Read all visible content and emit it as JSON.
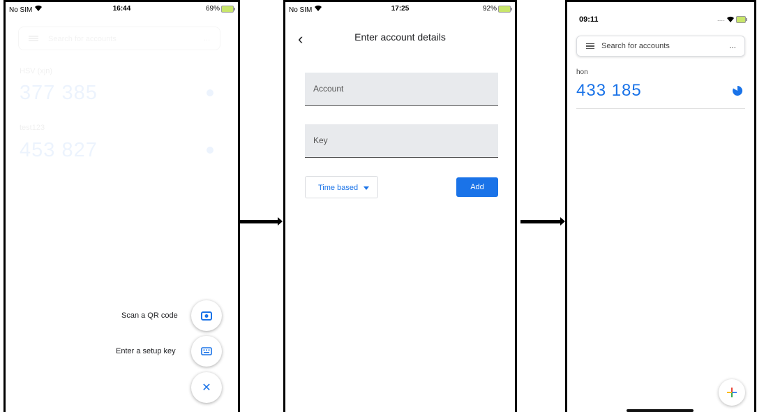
{
  "screen1": {
    "status": {
      "carrier": "No SIM",
      "time": "16:44",
      "battery": "69%"
    },
    "search_placeholder": "Search for accounts",
    "more": "...",
    "accounts": [
      {
        "name": "HSV (xjn)",
        "code": "377 385"
      },
      {
        "name": "test123",
        "code": "453 827"
      }
    ],
    "fab_menu": {
      "scan_label": "Scan a QR code",
      "key_label": "Enter a setup key",
      "close_glyph": "✕"
    }
  },
  "screen2": {
    "status": {
      "carrier": "No SIM",
      "time": "17:25",
      "battery": "92%"
    },
    "back_glyph": "‹",
    "title": "Enter account details",
    "account_placeholder": "Account",
    "key_placeholder": "Key",
    "type_select": "Time based",
    "add_label": "Add"
  },
  "screen3": {
    "status": {
      "time": "09:11",
      "signal": "...."
    },
    "search_placeholder": "Search for accounts",
    "more": "...",
    "account": {
      "name": "hon",
      "code": "433 185"
    },
    "add_glyph": "+"
  },
  "colors": {
    "accent": "#1a73e8",
    "field_bg": "#e8eaed"
  }
}
